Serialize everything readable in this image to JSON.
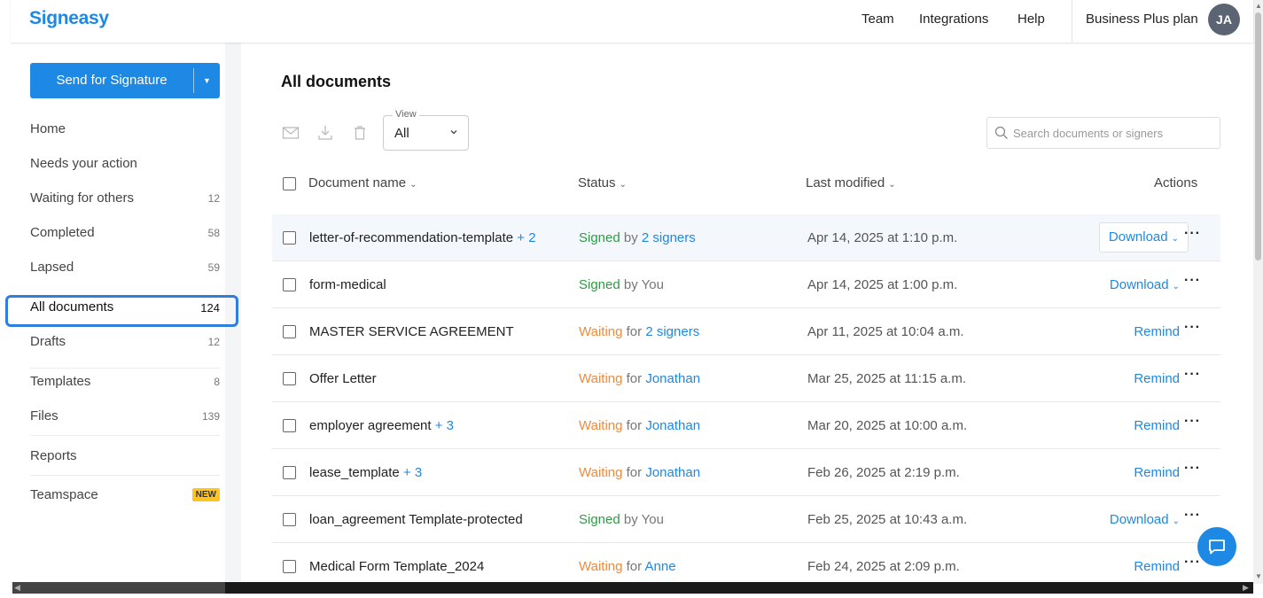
{
  "header": {
    "logo": "Signeasy",
    "nav": [
      "Team",
      "Integrations",
      "Help"
    ],
    "plan": "Business Plus plan",
    "avatar_initials": "JA"
  },
  "sidebar": {
    "send_label": "Send for Signature",
    "items": [
      {
        "label": "Home",
        "count": ""
      },
      {
        "label": "Needs your action",
        "count": ""
      },
      {
        "label": "Waiting for others",
        "count": "12"
      },
      {
        "label": "Completed",
        "count": "58"
      },
      {
        "label": "Lapsed",
        "count": "59"
      },
      {
        "label": "All documents",
        "count": "124"
      },
      {
        "label": "Drafts",
        "count": "12"
      },
      {
        "label": "Templates",
        "count": "8"
      },
      {
        "label": "Files",
        "count": "139"
      },
      {
        "label": "Reports",
        "count": ""
      },
      {
        "label": "Teamspace",
        "badge": "NEW"
      }
    ],
    "active_item": "All documents"
  },
  "main": {
    "title": "All documents",
    "view": {
      "label": "View",
      "value": "All"
    },
    "search_placeholder": "Search documents or signers",
    "columns": [
      "Document name",
      "Status",
      "Last modified",
      "Actions"
    ],
    "rows": [
      {
        "name": "letter-of-recommendation-template",
        "extra": "+ 2",
        "status": "Signed",
        "mid": "by",
        "who": "2 signers",
        "date": "Apr 14, 2025 at 1:10 p.m.",
        "action": "Download"
      },
      {
        "name": "form-medical",
        "extra": "",
        "status": "Signed",
        "mid": "by You",
        "who": "",
        "date": "Apr 14, 2025 at 1:00 p.m.",
        "action": "Download"
      },
      {
        "name": "MASTER SERVICE AGREEMENT",
        "extra": "",
        "status": "Waiting",
        "mid": "for",
        "who": "2 signers",
        "date": "Apr 11, 2025 at 10:04 a.m.",
        "action": "Remind"
      },
      {
        "name": "Offer Letter",
        "extra": "",
        "status": "Waiting",
        "mid": "for",
        "who": "Jonathan",
        "date": "Mar 25, 2025 at 11:15 a.m.",
        "action": "Remind"
      },
      {
        "name": "employer agreement",
        "extra": "+ 3",
        "status": "Waiting",
        "mid": "for",
        "who": "Jonathan",
        "date": "Mar 20, 2025 at 10:00 a.m.",
        "action": "Remind"
      },
      {
        "name": "lease_template",
        "extra": "+ 3",
        "status": "Waiting",
        "mid": "for",
        "who": "Jonathan",
        "date": "Feb 26, 2025 at 2:19 p.m.",
        "action": "Remind"
      },
      {
        "name": "loan_agreement Template-protected",
        "extra": "",
        "status": "Signed",
        "mid": "by You",
        "who": "",
        "date": "Feb 25, 2025 at 10:43 a.m.",
        "action": "Download"
      },
      {
        "name": "Medical Form Template_2024",
        "extra": "",
        "status": "Waiting",
        "mid": "for",
        "who": "Anne",
        "date": "Feb 24, 2025 at 2:09 p.m.",
        "action": "Remind"
      }
    ]
  },
  "colors": {
    "accent": "#1e88e5",
    "signed": "#2e9b47",
    "waiting": "#f08a3c",
    "badge": "#ffc41f"
  }
}
